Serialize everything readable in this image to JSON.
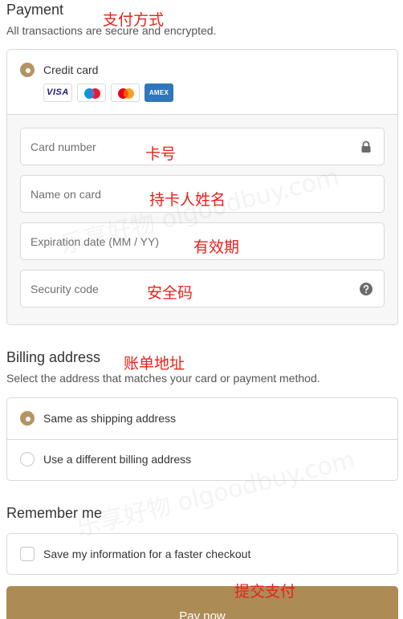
{
  "payment": {
    "title": "Payment",
    "subtitle": "All transactions are secure and encrypted.",
    "annotation": "支付方式",
    "method": {
      "label": "Credit card",
      "selected": true,
      "card_logos": [
        "visa-logo",
        "maestro-logo",
        "mastercard-logo",
        "amex-logo"
      ],
      "visa_text": "VISA",
      "amex_text": "AMEX"
    },
    "fields": {
      "card_number": {
        "placeholder": "Card number",
        "annotation": "卡号",
        "icon": "lock-icon"
      },
      "name_on_card": {
        "placeholder": "Name on card",
        "annotation": "持卡人姓名"
      },
      "expiration": {
        "placeholder": "Expiration date (MM / YY)",
        "annotation": "有效期"
      },
      "security_code": {
        "placeholder": "Security code",
        "annotation": "安全码",
        "icon": "help-icon"
      }
    }
  },
  "billing": {
    "title": "Billing address",
    "annotation": "账单地址",
    "subtitle": "Select the address that matches your card or payment method.",
    "options": [
      {
        "label": "Same as shipping address",
        "selected": true
      },
      {
        "label": "Use a different billing address",
        "selected": false
      }
    ]
  },
  "remember": {
    "title": "Remember me",
    "checkbox_label": "Save my information for a faster checkout",
    "checked": false
  },
  "submit": {
    "label": "Pay now",
    "annotation": "提交支付"
  },
  "watermark": "乐享好物 olgoodbuy.com",
  "colors": {
    "accent": "#b59363",
    "button": "#ad8b55",
    "annotation": "#e8211a",
    "border": "#d9d9d9"
  }
}
